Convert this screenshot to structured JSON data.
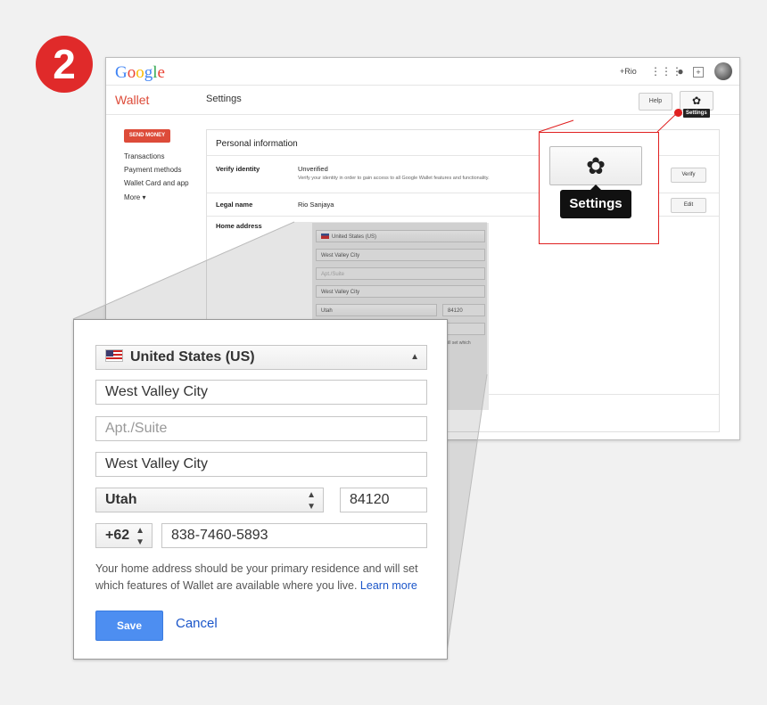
{
  "step": {
    "number": "2"
  },
  "topbar": {
    "logo": "Google",
    "user": "+Rio",
    "apps_icon": "apps-grid-icon",
    "notif_icon": "notifications-icon",
    "share_icon": "share-icon"
  },
  "header": {
    "app_title": "Wallet",
    "page_title": "Settings",
    "help_label": "Help",
    "settings_tooltip": "Settings"
  },
  "sidebar": {
    "send_money": "SEND MONEY",
    "items": [
      "Transactions",
      "Payment methods",
      "Wallet Card and app",
      "More ▾"
    ]
  },
  "card": {
    "title": "Personal information",
    "verify": {
      "label": "Verify identity",
      "status": "Unverified",
      "sub": "Verify your identity in order to gain access to all Google Wallet features and functionality.",
      "button": "Verify"
    },
    "legal": {
      "label": "Legal name",
      "value": "Rio Sanjaya",
      "button": "Edit"
    },
    "address": {
      "label": "Home address"
    }
  },
  "zoom": {
    "tooltip": "Settings"
  },
  "form": {
    "country": "United States (US)",
    "address1": "West Valley City",
    "apt_placeholder": "Apt./Suite",
    "city": "West Valley City",
    "state": "Utah",
    "zip": "84120",
    "phone_code": "+62",
    "phone": "838-7460-5893",
    "help_text": "Your home address should be your primary residence and will set which features of Wallet are available where you live.",
    "learn_more": "Learn more",
    "save": "Save",
    "cancel": "Cancel"
  },
  "mini": {
    "country": "United States (US)",
    "address1": "West Valley City",
    "apt": "Apt./Suite",
    "city": "West Valley City",
    "state": "Utah",
    "zip": "84120",
    "partial": "l will set which"
  },
  "colors": {
    "accent_red": "#e02a2a",
    "save_blue": "#4d8ef1",
    "link_blue": "#1a55c9",
    "wallet_red": "#dd4b39"
  }
}
